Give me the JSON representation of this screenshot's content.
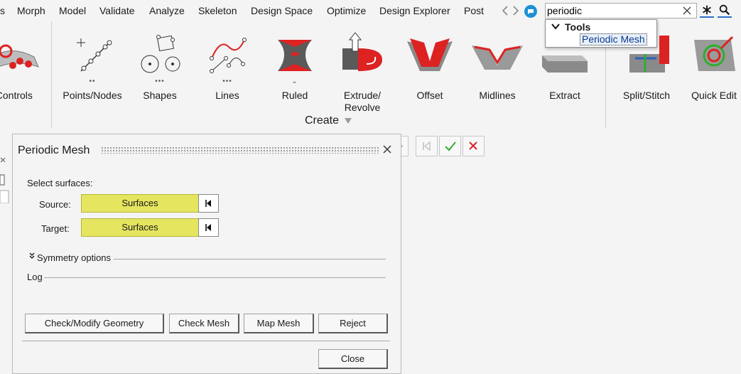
{
  "menubar": {
    "items": [
      "s",
      "Morph",
      "Model",
      "Validate",
      "Analyze",
      "Skeleton",
      "Design Space",
      "Optimize",
      "Design Explorer",
      "Post"
    ],
    "icons": [
      "chevron-left-icon",
      "chevron-right-icon",
      "chat-icon",
      "asterisk-icon",
      "search-icon"
    ]
  },
  "search": {
    "value": "periodic",
    "clear_icon": "close-icon"
  },
  "search_results": {
    "group": "Tools",
    "items": [
      "Periodic Mesh"
    ]
  },
  "ribbon": {
    "tools": [
      {
        "label": "n Controls",
        "icon": "morph-controls-icon"
      },
      {
        "label": "Points/Nodes",
        "icon": "points-nodes-icon",
        "dots": "••"
      },
      {
        "label": "Shapes",
        "icon": "shapes-icon",
        "dots": "•••"
      },
      {
        "label": "Lines",
        "icon": "lines-icon",
        "dots": "•••"
      },
      {
        "label": "Ruled",
        "icon": "ruled-icon",
        "dots": "⌄"
      },
      {
        "label": "Extrude/\nRevolve",
        "icon": "extrude-revolve-icon"
      },
      {
        "label": "Offset",
        "icon": "offset-icon"
      },
      {
        "label": "Midlines",
        "icon": "midlines-icon"
      },
      {
        "label": "Extract",
        "icon": "extract-icon"
      },
      {
        "label": "Split/Stitch",
        "icon": "split-stitch-icon"
      },
      {
        "label": "Quick Edit",
        "icon": "quick-edit-icon"
      }
    ],
    "group_label": "Create",
    "group_menu_icon": "triangle-down-icon"
  },
  "side_toolbar": {
    "icons": [
      "play-icon",
      "skip-back-icon",
      "check-icon",
      "close-icon"
    ],
    "colors": {
      "check": "#2fae2f",
      "cancel": "#d8262d"
    }
  },
  "panel": {
    "title": "Periodic Mesh",
    "select_label": "Select surfaces:",
    "source_label": "Source:",
    "source_value": "Surfaces",
    "target_label": "Target:",
    "target_value": "Surfaces",
    "symmetry_label": "Symmetry options",
    "log_label": "Log",
    "buttons": {
      "check_modify": "Check/Modify Geometry",
      "check_mesh": "Check Mesh",
      "map_mesh": "Map Mesh",
      "reject": "Reject",
      "close": "Close"
    },
    "collector_color": "#e5e560"
  }
}
